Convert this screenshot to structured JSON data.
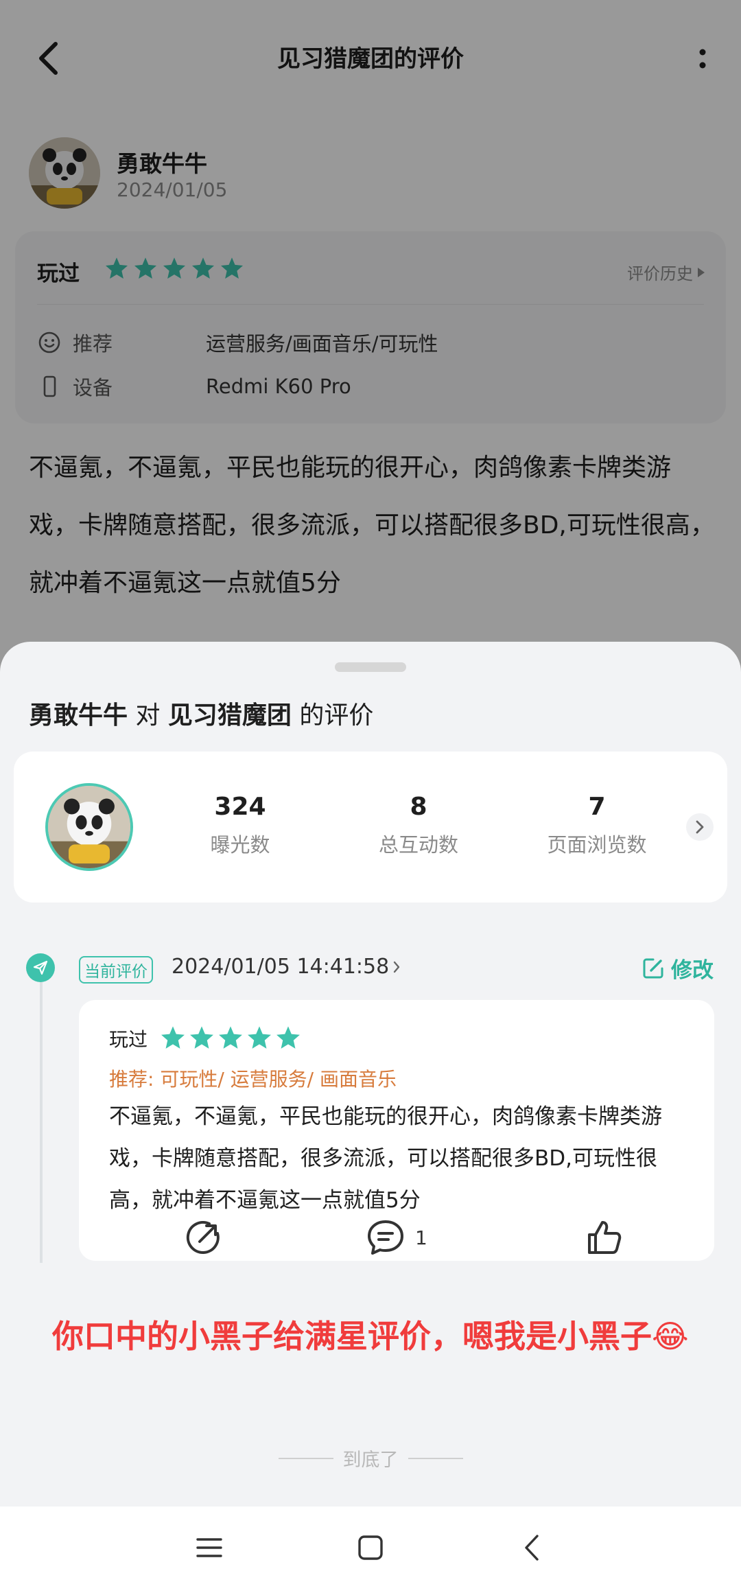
{
  "header": {
    "title": "见习猎魔团的评价"
  },
  "author": {
    "name": "勇敢牛牛",
    "date": "2024/01/05"
  },
  "info_card": {
    "played_label": "玩过",
    "rating": 5,
    "history_link": "评价历史",
    "recommend_key": "推荐",
    "recommend_value": "运营服务/画面音乐/可玩性",
    "device_key": "设备",
    "device_value": "Redmi K60 Pro"
  },
  "review_text": "不逼氪，不逼氪，平民也能玩的很开心，肉鸽像素卡牌类游戏，卡牌随意搭配，很多流派，可以搭配很多BD,可玩性很高，就冲着不逼氪这一点就值5分",
  "sheet": {
    "title_user": "勇敢牛牛",
    "title_mid": " 对 ",
    "title_game": "见习猎魔团",
    "title_end": " 的评价",
    "stats": [
      {
        "value": "324",
        "label": "曝光数"
      },
      {
        "value": "8",
        "label": "总互动数"
      },
      {
        "value": "7",
        "label": "页面浏览数"
      }
    ],
    "current_badge": "当前评价",
    "current_time": "2024/01/05 14:41:58",
    "edit_label": "修改",
    "card": {
      "played_label": "玩过",
      "rating": 5,
      "recommend": "推荐: 可玩性/ 运营服务/ 画面音乐",
      "text": "不逼氪，不逼氪，平民也能玩的很开心，肉鸽像素卡牌类游戏，卡牌随意搭配，很多流派，可以搭配很多BD,可玩性很高，就冲着不逼氪这一点就值5分",
      "comment_count": "1"
    },
    "caption": "你口中的小黑子给满星评价，嗯我是小黑子😂",
    "end_text": "到底了"
  },
  "colors": {
    "accent": "#3ec2ac",
    "star": "#3ec2ac",
    "recommend": "#d77b3c",
    "caption": "#f03c3c"
  },
  "icons": [
    "back-icon",
    "more-icon",
    "smile-icon",
    "phone-icon",
    "send-icon",
    "edit-icon",
    "share-icon",
    "comment-icon",
    "like-icon",
    "menu-icon",
    "home-icon",
    "back-nav-icon"
  ]
}
